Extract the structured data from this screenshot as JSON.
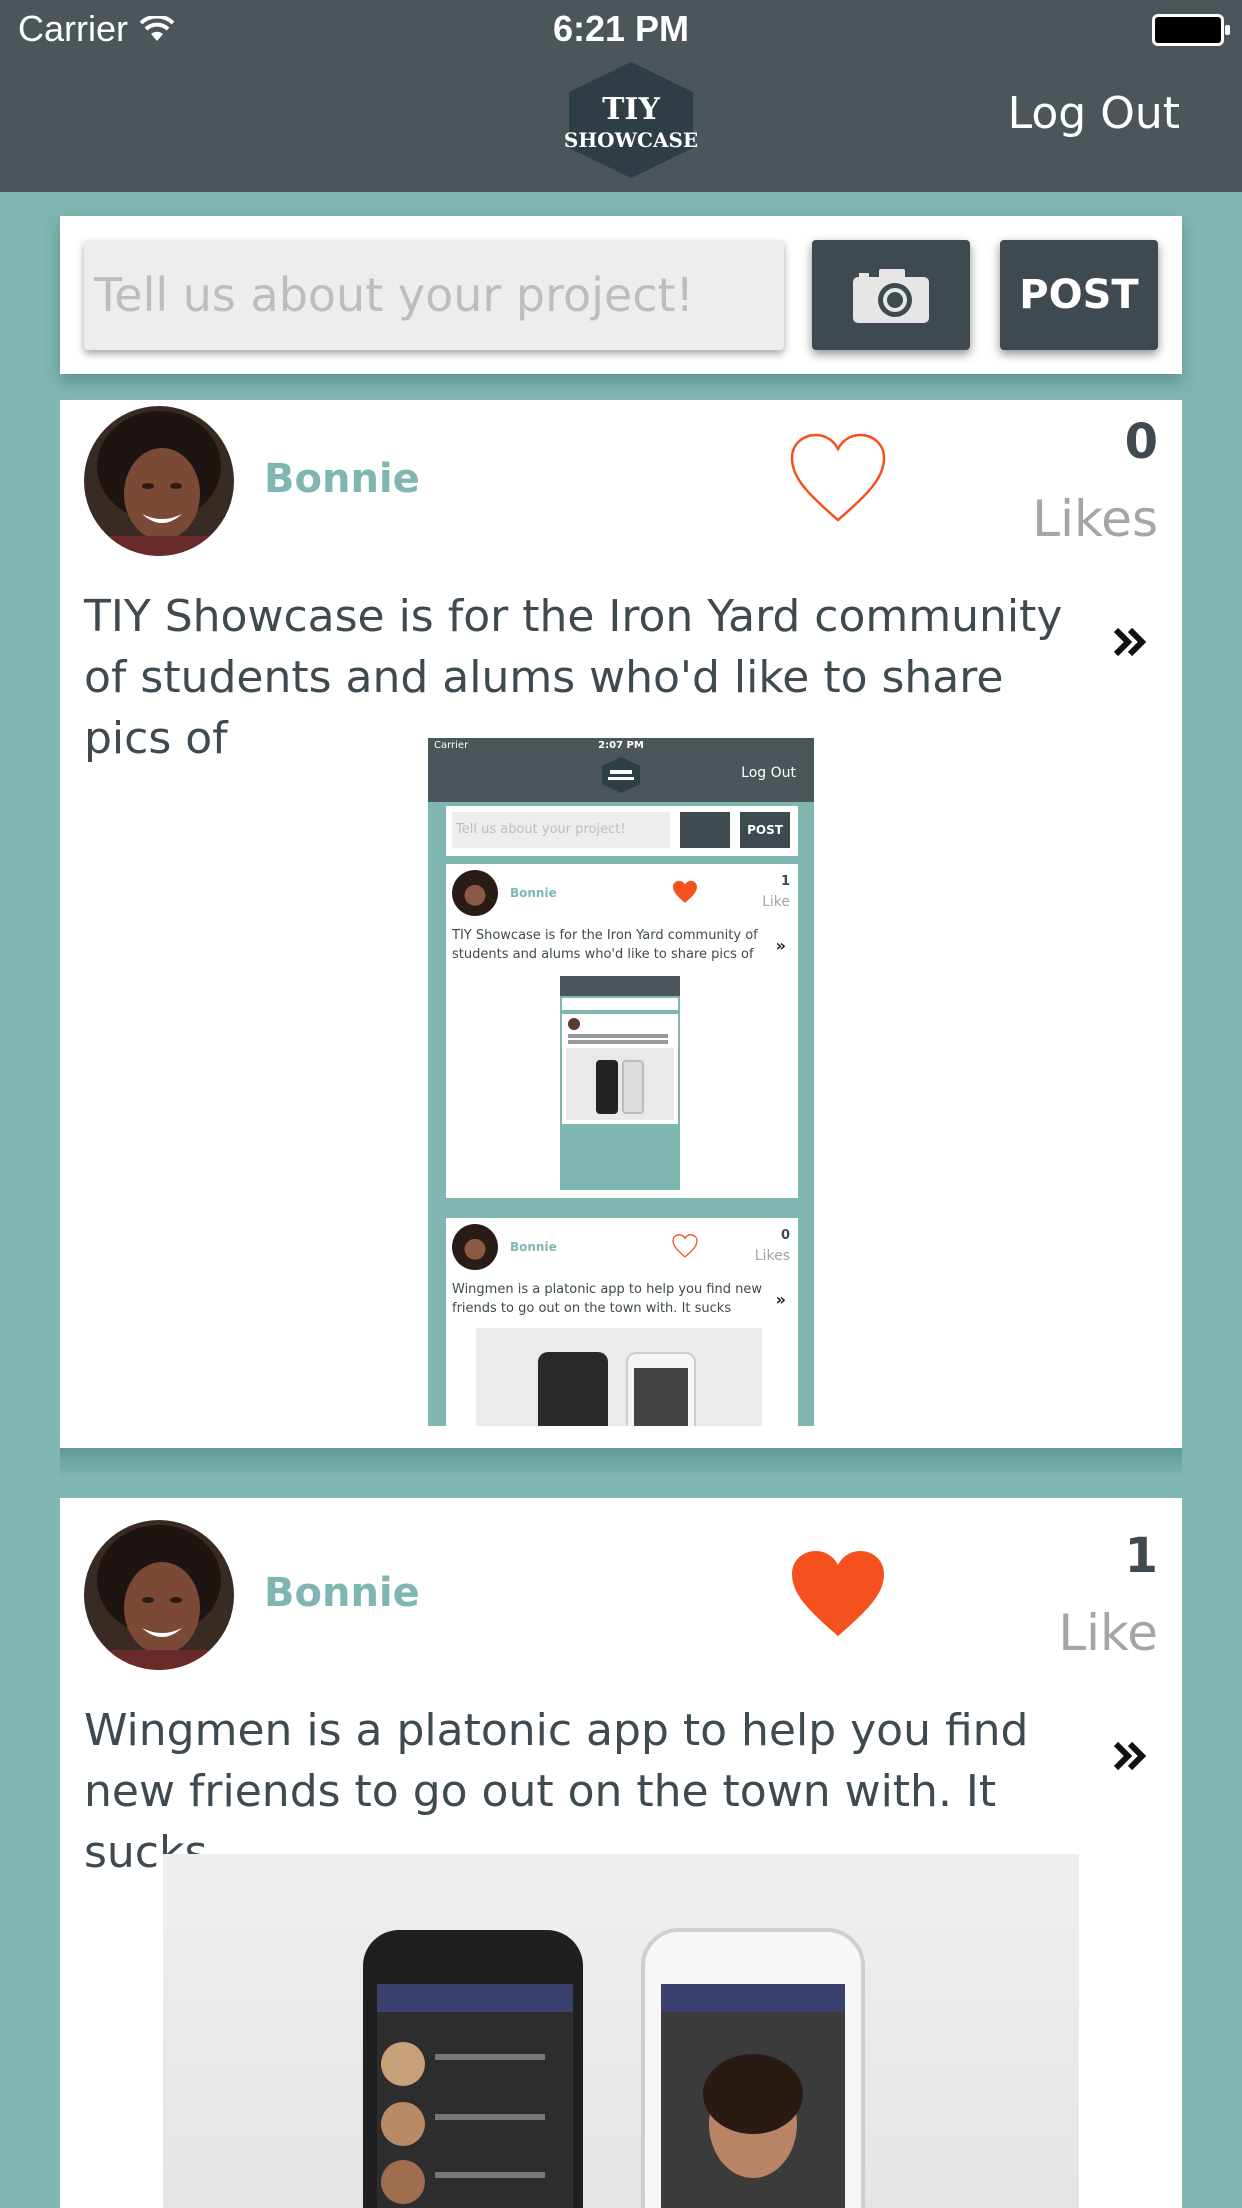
{
  "status_bar": {
    "carrier": "Carrier",
    "time": "6:21 PM"
  },
  "header": {
    "logo_line1": "TIY",
    "logo_line2": "SHOWCASE",
    "logout_label": "Log Out"
  },
  "composer": {
    "placeholder": "Tell us about your project!",
    "post_label": "POST"
  },
  "posts": [
    {
      "user": "Bonnie",
      "liked": false,
      "like_count": "0",
      "like_label": "Likes",
      "description": "TIY Showcase is for the Iron Yard community of students and alums who'd like to share pics of",
      "image_content": {
        "status_carrier": "Carrier",
        "status_time": "2:07 PM",
        "logout_label": "Log Out",
        "placeholder": "Tell us about your project!",
        "post_label": "POST",
        "posts": [
          {
            "user": "Bonnie",
            "like_count": "1",
            "like_label": "Like",
            "description": "TIY Showcase is for the Iron Yard community of students and alums who'd like to share pics of"
          },
          {
            "user": "Bonnie",
            "like_count": "0",
            "like_label": "Likes",
            "description": "Wingmen is a platonic app to help you find new friends to go out on the town with. It sucks"
          }
        ]
      }
    },
    {
      "user": "Bonnie",
      "liked": true,
      "like_count": "1",
      "like_label": "Like",
      "description": "Wingmen is a platonic app to help you find new friends to go out on the town with. It sucks"
    }
  ],
  "colors": {
    "header_bg": "#4B555A",
    "page_bg": "#7FB6B2",
    "accent_heart": "#F4511E",
    "username": "#7FB6B2",
    "button_bg": "#3F4A50"
  },
  "icons": [
    "wifi-icon",
    "battery-icon",
    "camera-icon",
    "heart-outline-icon",
    "heart-filled-icon",
    "double-chevron-right-icon"
  ]
}
